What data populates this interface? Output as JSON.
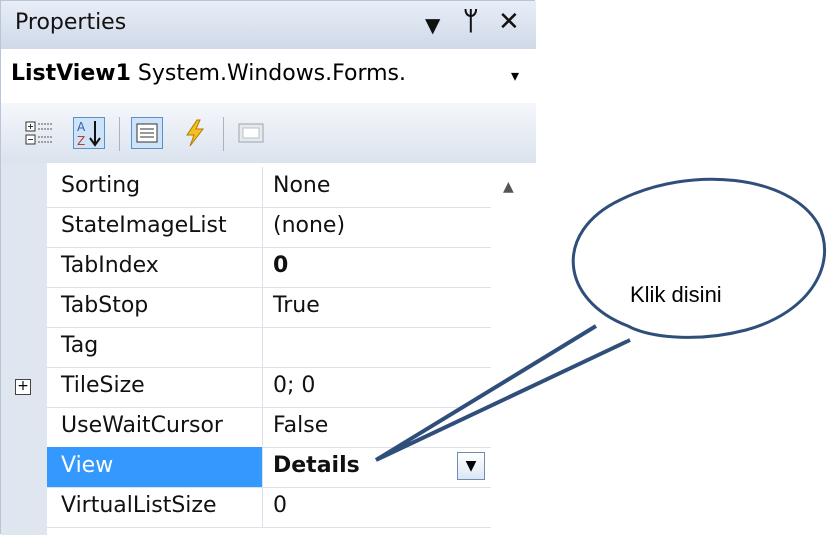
{
  "properties_window": {
    "title": "Properties",
    "controls": {
      "dropdown_glyph": "▼",
      "pin_glyph": "ᛘ",
      "close_glyph": "✕"
    },
    "object_selector": {
      "name": "ListView1",
      "type": "System.Windows.Forms.",
      "dropdown_glyph": "▾"
    },
    "toolbar": {
      "buttons": [
        "categorized-icon",
        "alphabetical-icon",
        "properties-icon",
        "events-icon",
        "property-pages-icon"
      ]
    },
    "rows": [
      {
        "name": "Sorting",
        "value": "None"
      },
      {
        "name": "StateImageList",
        "value": "(none)"
      },
      {
        "name": "TabIndex",
        "value": "0"
      },
      {
        "name": "TabStop",
        "value": "True"
      },
      {
        "name": "Tag",
        "value": ""
      },
      {
        "name": "TileSize",
        "value": "0; 0",
        "expandable": true
      },
      {
        "name": "UseWaitCursor",
        "value": "False"
      },
      {
        "name": "View",
        "value": "Details",
        "selected": true
      },
      {
        "name": "VirtualListSize",
        "value": "0"
      }
    ],
    "scroll_up_glyph": "▲",
    "colors": {
      "selection": "#3399ff",
      "panel": "#d9e1ec"
    }
  },
  "callout": {
    "text": "Klik disini",
    "stroke_color": "#2f4f7a"
  }
}
